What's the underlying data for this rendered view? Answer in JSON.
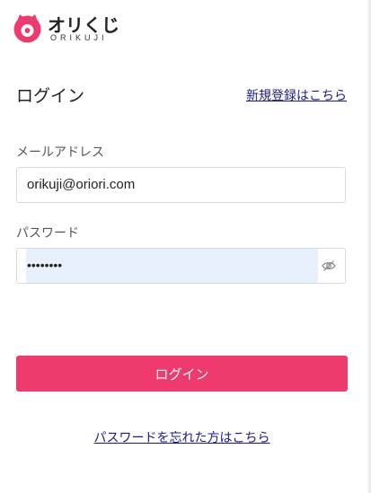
{
  "brand": {
    "name": "オリくじ",
    "subtitle": "ORIKUJI",
    "logo_icon": "cat-face-logo-icon",
    "accent": "#ee3a6d"
  },
  "page": {
    "title": "ログイン",
    "register_link": "新規登録はこちら"
  },
  "form": {
    "email_label": "メールアドレス",
    "email_value": "orikuji@oriori.com",
    "password_label": "パスワード",
    "password_value": "••••••••",
    "password_toggle_icon": "eye-slash-icon",
    "autofill_color": "#e8f0fe"
  },
  "actions": {
    "login_button": "ログイン",
    "forgot_link": "パスワードを忘れた方はこちら",
    "button_color": "#ee3a6d"
  }
}
